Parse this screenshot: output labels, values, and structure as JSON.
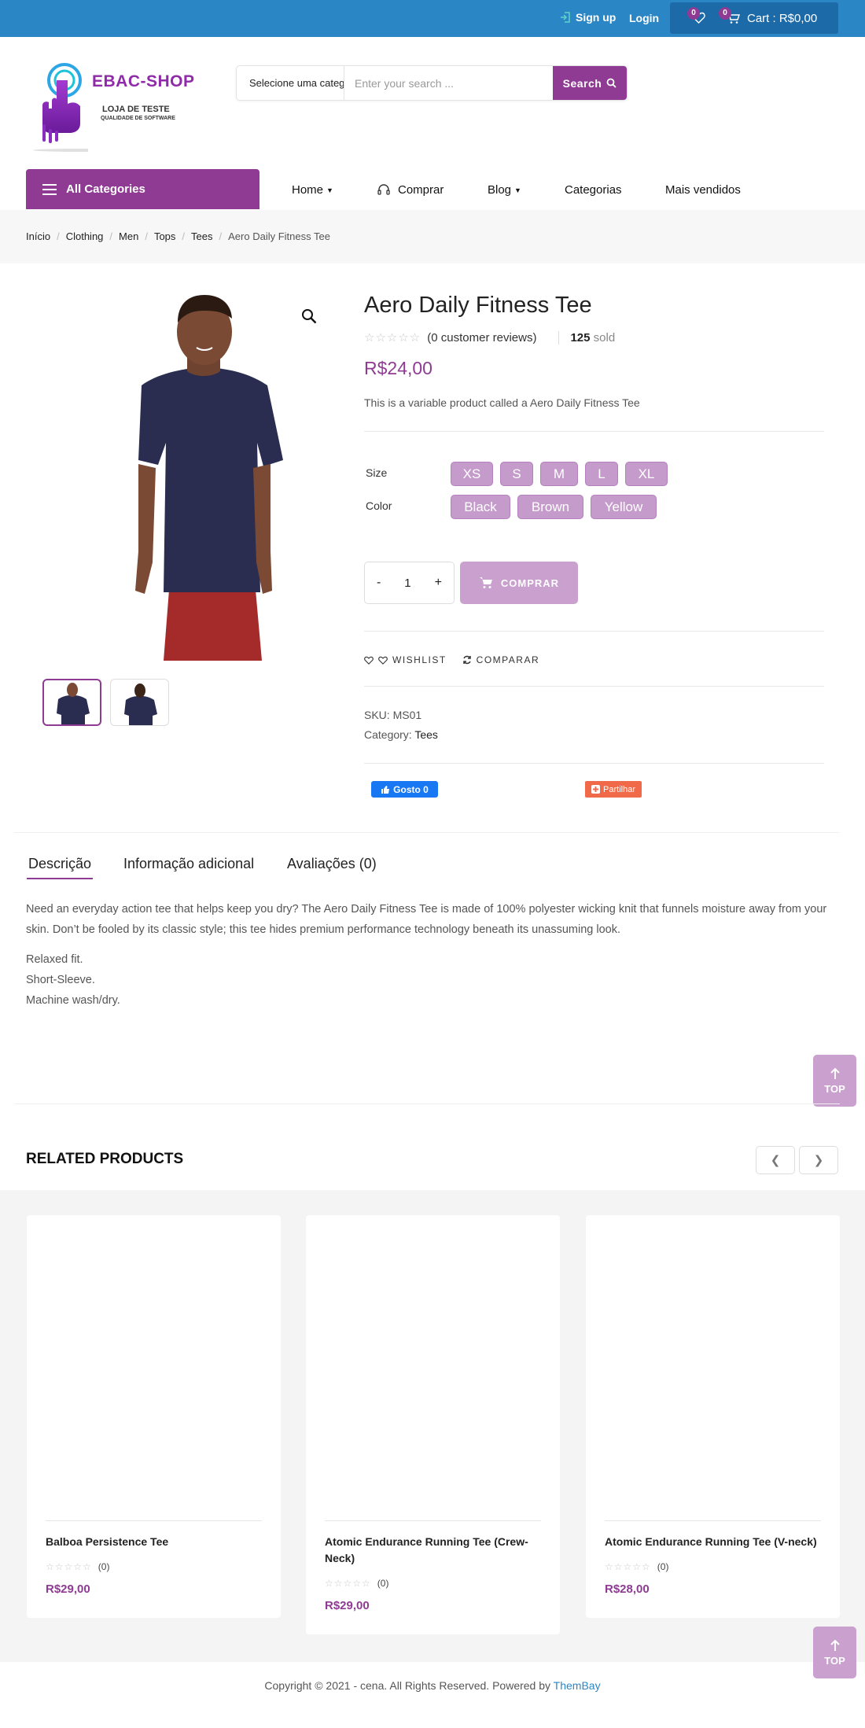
{
  "topbar": {
    "signup": "Sign up",
    "login": "Login",
    "wishlist_count": "0",
    "cart_count": "0",
    "cart_label": "Cart : R$0,00"
  },
  "logo": {
    "title": "EBAC-SHOP",
    "subtitle": "LOJA DE TESTE",
    "tagline": "QUALIDADE DE SOFTWARE"
  },
  "search": {
    "category": "Selecione uma categoria",
    "placeholder": "Enter your search ...",
    "button": "Search"
  },
  "nav": {
    "all_categories": "All Categories",
    "items": [
      "Home",
      "Comprar",
      "Blog",
      "Categorias",
      "Mais vendidos"
    ]
  },
  "breadcrumb": [
    "Início",
    "Clothing",
    "Men",
    "Tops",
    "Tees",
    "Aero Daily Fitness Tee"
  ],
  "product": {
    "title": "Aero Daily Fitness Tee",
    "reviews": "(0 customer reviews)",
    "sold_count": "125",
    "sold_label": "sold",
    "price": "R$24,00",
    "short_description": "This is a variable product called a Aero Daily Fitness Tee",
    "size_label": "Size",
    "sizes": [
      "XS",
      "S",
      "M",
      "L",
      "XL"
    ],
    "color_label": "Color",
    "colors": [
      "Black",
      "Brown",
      "Yellow"
    ],
    "qty_minus": "-",
    "qty": "1",
    "qty_plus": "+",
    "buy_button": "COMPRAR",
    "wishlist": "WISHLIST",
    "compare": "COMPARAR",
    "sku_label": "SKU:",
    "sku": "MS01",
    "category_label": "Category:",
    "category": "Tees",
    "fb_like": "Gosto 0",
    "share": "Partilhar"
  },
  "tabs": [
    "Descrição",
    "Informação adicional",
    "Avaliações (0)"
  ],
  "description": {
    "paragraph": "Need an everyday action tee that helps keep you dry? The Aero Daily Fitness Tee is made of 100% polyester wicking knit that funnels moisture away from your skin. Don’t be fooled by its classic style; this tee hides premium performance technology beneath its unassuming look.",
    "features": [
      "Relaxed fit.",
      "Short-Sleeve.",
      "Machine wash/dry."
    ]
  },
  "top_button": "TOP",
  "related": {
    "heading": "RELATED PRODUCTS",
    "products": [
      {
        "name": "Balboa Persistence Tee",
        "reviews": "(0)",
        "price": "R$29,00"
      },
      {
        "name": "Atomic Endurance Running Tee (Crew-Neck)",
        "reviews": "(0)",
        "price": "R$29,00"
      },
      {
        "name": "Atomic Endurance Running Tee (V-neck)",
        "reviews": "(0)",
        "price": "R$28,00"
      }
    ]
  },
  "footer": {
    "text": "Copyright © 2021 - cena. All Rights Reserved. Powered by ",
    "link": "ThemBay"
  },
  "colors": {
    "accent": "#8f3b93",
    "topbar": "#2b86c5",
    "swatch": "#c49bca"
  },
  "icons": [
    "signup-icon",
    "heart-icon",
    "cart-icon",
    "search-icon",
    "menu-icon",
    "headset-icon",
    "zoom-icon",
    "star-icon",
    "refresh-icon",
    "thumbs-up-icon",
    "plus-icon",
    "arrow-up-icon",
    "chevron-left-icon",
    "chevron-right-icon"
  ]
}
